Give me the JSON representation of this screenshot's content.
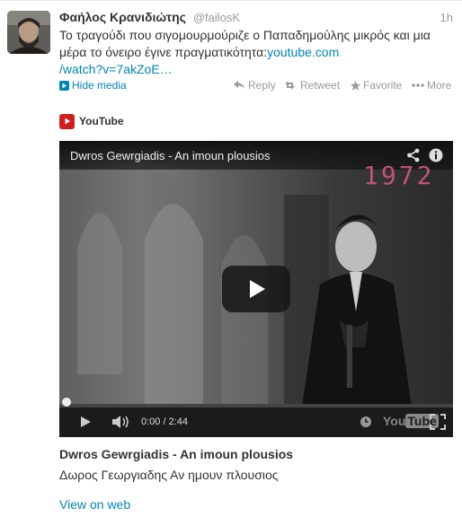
{
  "tweet": {
    "author_name": "Φαήλος Κρανιδιώτης",
    "handle": "@failosK",
    "time": "1h",
    "text": "Το τραγούδι που σιγομουρμούριζε ο Παπαδημούλης μικρός και μια μέρα το όνειρο έγινε πραγματικότητα:",
    "link_text_1": "youtube.com",
    "link_text_2": "/watch?v=7akZoE…"
  },
  "actions": {
    "hide_media": "Hide media",
    "reply": "Reply",
    "retweet": "Retweet",
    "favorite": "Favorite",
    "more": "More"
  },
  "media": {
    "provider": "YouTube",
    "video_title": "Dwros Gewrgiadis - An imoun plousios",
    "overlay_year": "1972",
    "time_current": "0:00",
    "time_total": "2:44",
    "player_logo_you": "You",
    "player_logo_tube": "Tube",
    "card_title": "Dwros Gewrgiadis - An imoun plousios",
    "card_description": "Δωρος Γεωργιαδης Αν ημουν πλουσιος",
    "view_on_web": "View on web"
  },
  "colors": {
    "link": "#0084b4",
    "youtube_red": "#cd201f",
    "muted": "#999999"
  }
}
